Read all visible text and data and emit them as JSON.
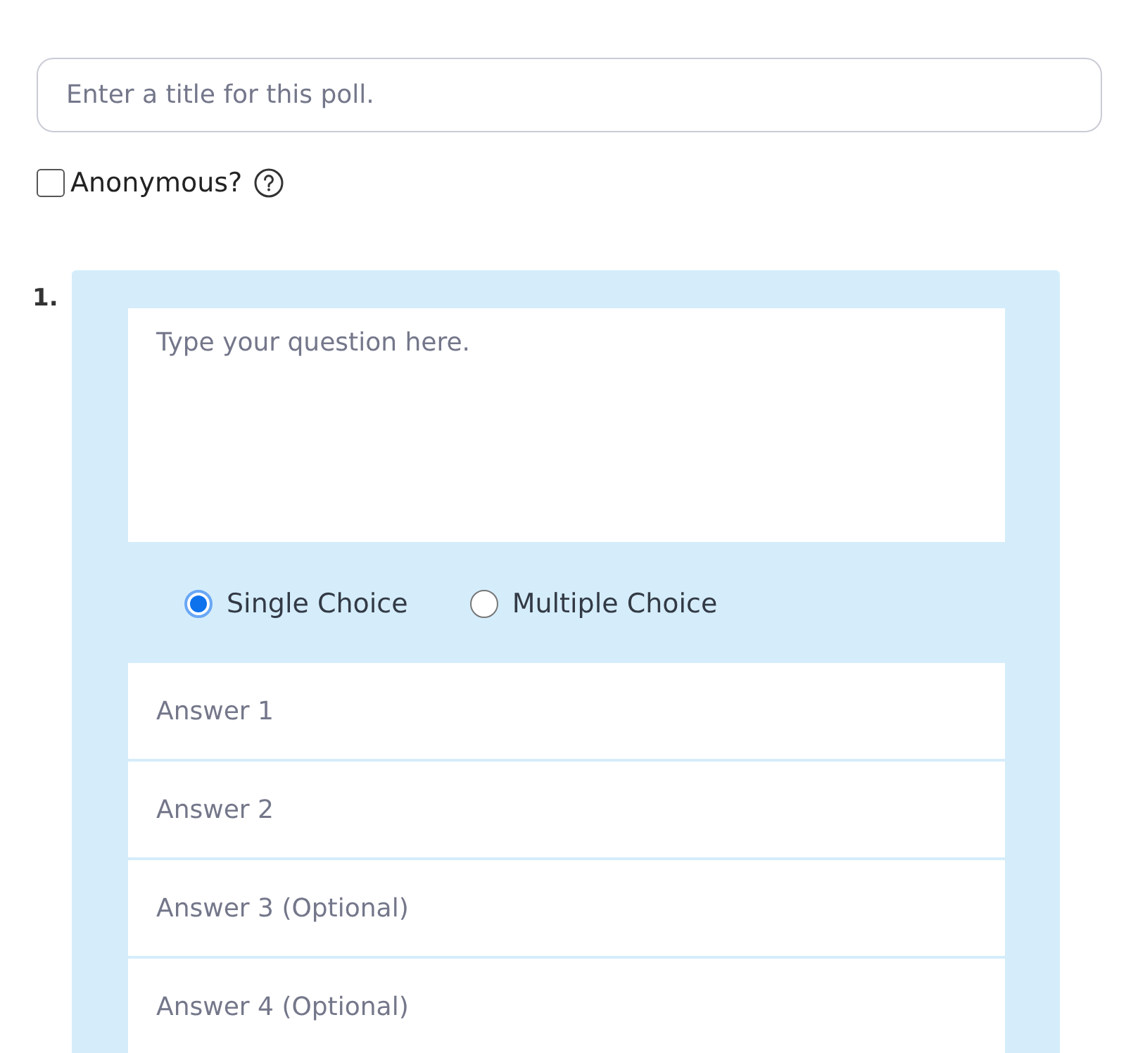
{
  "poll_title": {
    "placeholder": "Enter a title for this poll."
  },
  "anonymous": {
    "label": "Anonymous?",
    "checked": false
  },
  "question": {
    "number": "1.",
    "placeholder": "Type your question here.",
    "choice_types": [
      {
        "label": "Single Choice",
        "selected": true
      },
      {
        "label": "Multiple Choice",
        "selected": false
      }
    ],
    "answers": [
      {
        "placeholder": "Answer 1"
      },
      {
        "placeholder": "Answer 2"
      },
      {
        "placeholder": "Answer 3 (Optional)"
      },
      {
        "placeholder": "Answer 4 (Optional)"
      }
    ]
  }
}
